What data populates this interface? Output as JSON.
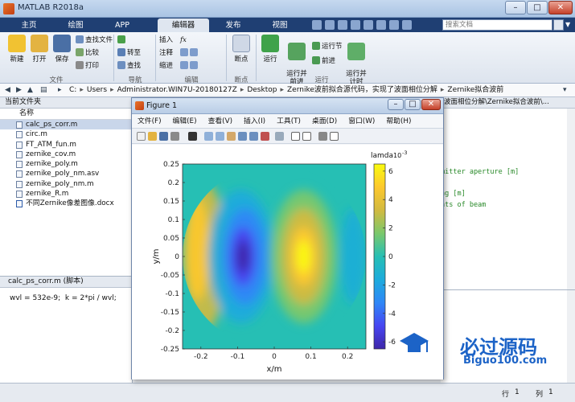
{
  "window": {
    "title": "MATLAB R2018a",
    "min": "–",
    "max": "□",
    "close": "✕"
  },
  "tabs": [
    "主页",
    "绘图",
    "APP",
    "编辑器",
    "发布",
    "视图"
  ],
  "search": {
    "placeholder": "搜索文档"
  },
  "ribbon": {
    "file": {
      "new": "新建",
      "open": "打开",
      "save": "保存",
      "find_files": "查找文件",
      "compare": "比较",
      "print": "打印",
      "label": "文件"
    },
    "navigate": {
      "goto": "转至",
      "find": "查找",
      "label": "导航"
    },
    "edit": {
      "insert": "插入",
      "comment": "注释",
      "indent": "缩进",
      "fx": "fx",
      "label": "编辑"
    },
    "breakpoints": {
      "breakpoints": "断点",
      "label": "断点"
    },
    "run": {
      "run": "运行",
      "run_advance": "运行并\n前进",
      "run_section": "运行节",
      "advance": "前进",
      "run_time": "运行并\n计时",
      "label": "运行"
    }
  },
  "address": {
    "parts": [
      "C:",
      "Users",
      "Administrator.WIN7U-20180127Z",
      "Desktop",
      "Zernike波前拟合源代码，实现了波面相位分解",
      "Zernike拟合波前"
    ]
  },
  "file_panel": {
    "header": "当前文件夹",
    "column": "名称",
    "files": [
      "calc_ps_corr.m",
      "circ.m",
      "FT_ATM_fun.m",
      "zernike_cov.m",
      "zernike_poly.m",
      "zernike_poly_nm.asv",
      "zernike_poly_nm.m",
      "zernike_R.m",
      "不同Zernike像差图像.docx"
    ]
  },
  "details": {
    "title": "calc_ps_corr.m  (脚本)",
    "code": "wvl = 532e-9;  k = 2*pi / wvl;"
  },
  "editor": {
    "tab": "波面相位分解\\Zernike拟合波前\\...",
    "lines": [
      "mitter aperture [m]",
      "ng [m]",
      "nts of beam"
    ]
  },
  "status": {
    "row_label": "行",
    "row": "1",
    "col_label": "列",
    "col": "1"
  },
  "figure": {
    "title": "Figure 1",
    "menu": [
      "文件(F)",
      "编辑(E)",
      "查看(V)",
      "插入(I)",
      "工具(T)",
      "桌面(D)",
      "窗口(W)",
      "帮助(H)"
    ]
  },
  "watermark": {
    "main": "必过源码",
    "sub": "Biguo100.com"
  },
  "chart_data": {
    "type": "heatmap",
    "xlabel": "x/m",
    "ylabel": "y/m",
    "x_ticks": [
      "-0.2",
      "-0.1",
      "0",
      "0.1",
      "0.2"
    ],
    "y_ticks": [
      "0.25",
      "0.2",
      "0.15",
      "0.1",
      "0.05",
      "0",
      "-0.05",
      "-0.1",
      "-0.15",
      "-0.2",
      "-0.25"
    ],
    "xlim": [
      -0.25,
      0.25
    ],
    "ylim": [
      -0.25,
      0.25
    ],
    "colorbar": {
      "label": "lamda",
      "exponent": "10",
      "exponent_power": "-3",
      "ticks": [
        "6",
        "4",
        "2",
        "0",
        "-2",
        "-4",
        "-6"
      ],
      "range": [
        -6.5,
        6.5
      ]
    },
    "colormap": "parula",
    "colors": [
      "#3e26a8",
      "#4746f2",
      "#2e87f7",
      "#1cabdc",
      "#26bfb4",
      "#7bc86c",
      "#d2ba40",
      "#fdc82d",
      "#f9fb0e"
    ],
    "background_color": "#26bfb4"
  }
}
